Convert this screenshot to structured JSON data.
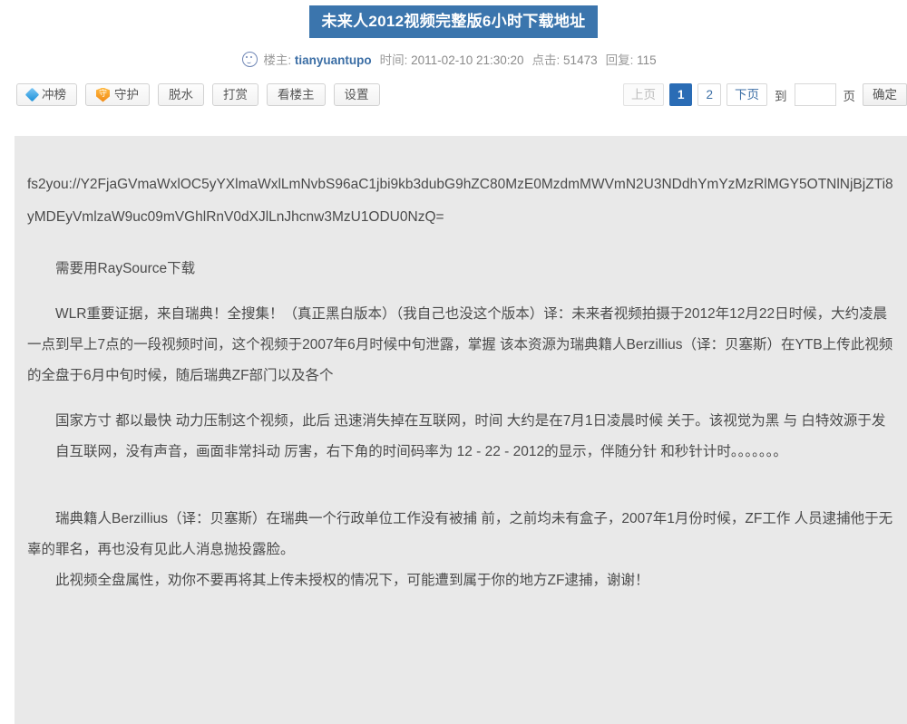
{
  "thread": {
    "title": "未来人2012视频完整版6小时下载地址"
  },
  "meta": {
    "icon": "smiley-face-icon",
    "author_label": "楼主:",
    "author": "tianyuantupo",
    "time_label": "时间:",
    "time": "2011-02-10 21:30:20",
    "views_label": "点击:",
    "views": "51473",
    "replies_label": "回复:",
    "replies": "115"
  },
  "toolbar": {
    "buttons": [
      {
        "label": "冲榜",
        "icon": "diamond-icon"
      },
      {
        "label": "守护",
        "icon": "shield-icon",
        "icon_char": "守"
      },
      {
        "label": "脱水",
        "icon": ""
      },
      {
        "label": "打赏",
        "icon": ""
      },
      {
        "label": "看楼主",
        "icon": ""
      },
      {
        "label": "设置",
        "icon": ""
      }
    ]
  },
  "pagination": {
    "prev": "上页",
    "pages": [
      "1",
      "2"
    ],
    "active_page": "1",
    "next": "下页",
    "jump_prefix": "到",
    "jump_value": "",
    "jump_placeholder": "",
    "jump_suffix": "页",
    "confirm": "确定"
  },
  "post": {
    "download_link_line1": "fs2you://Y2FjaGVmaWxlOC5yYXlmaWxlLmNvbS96aC1jbi9kb3dubG9hZC80MzE0MzdmMWVmN2U3NDdhYmYzMzRlMGY5OTNlNjBjZTi8yMDEyVmlzaW9uc09mVGhlRnV0dXJlLnJhcnw3MzU1ODU0NzQ=",
    "download_link_line1_display": "fs2you://Y2FjaGVmaWxlOC5yYXlmaWxlLmNvbS96aC1jbi9kb3dubG9hZC80MzE0MzdmMWVmN2U3NDdhYmYzMzRlMGY5OTNlNjBjZTi8yMDEyVmlzaW9uc09mVGhlRnV0dXJlLnJhcnw3MzU1ODU0NzQ=",
    "note": "需要用RaySource下载",
    "para1": "WLR重要证据，来自瑞典！全搜集！（真正黑白版本）（我自己也没这个版本）译：未来者视频拍摄于2012年12月22日时候，大约凌晨一点到早上7点的一段视频时间，这个视频于2007年6月时候中旬泄露，掌握 该本资源为瑞典籍人Berzillius（译：贝塞斯）在YTB上传此视频的全盘于6月中旬时候，随后瑞典ZF部门以及各个",
    "para2": "国家方寸 都以最快 动力压制这个视频，此后 迅速消失掉在互联网，时间 大约是在7月1日凌晨时候 关于。该视觉为黑 与 白特效源于发",
    "para3": "自互联网，没有声音，画面非常抖动 厉害，右下角的时间码率为 12 - 22 - 2012的显示，伴随分针 和秒针计时。。。。。。。",
    "para4": "瑞典籍人Berzillius（译：贝塞斯）在瑞典一个行政单位工作没有被捕 前，之前均未有盒子，2007年1月份时候，ZF工作 人员逮捕他于无辜的罪名，再也没有见此人消息抛投露脸。",
    "para5": "此视频全盘属性，劝你不要再将其上传未授权的情况下，可能遭到属于你的地方ZF逮捕，谢谢！"
  }
}
